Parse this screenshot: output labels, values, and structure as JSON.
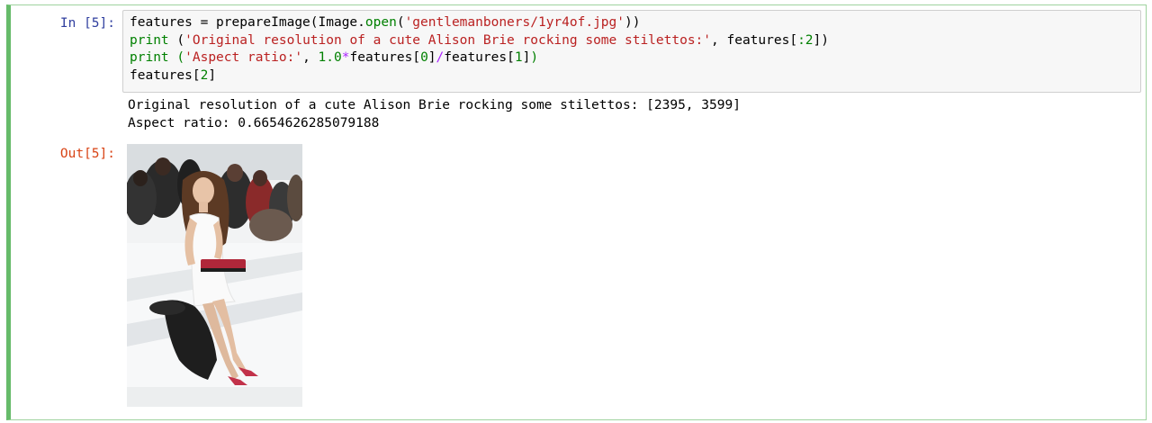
{
  "cell": {
    "input_prompt": "In [5]:",
    "output_prompt": "Out[5]:",
    "code_lines": [
      [
        {
          "text": "features = prepareImage(Image.",
          "cls": "tx"
        },
        {
          "text": "open",
          "cls": "kw"
        },
        {
          "text": "(",
          "cls": "tx"
        },
        {
          "text": "'gentlemanboners/1yr4of.jpg'",
          "cls": "str"
        },
        {
          "text": "))",
          "cls": "tx"
        }
      ],
      [
        {
          "text": "print",
          "cls": "kw"
        },
        {
          "text": " (",
          "cls": "tx"
        },
        {
          "text": "'Original resolution of a cute Alison Brie rocking some stilettos:'",
          "cls": "str"
        },
        {
          "text": ", features[",
          "cls": "tx"
        },
        {
          "text": ":2",
          "cls": "num"
        },
        {
          "text": "])",
          "cls": "tx"
        }
      ],
      [
        {
          "text": "print",
          "cls": "kw"
        },
        {
          "text": " (",
          "cls": "kw"
        },
        {
          "text": "'Aspect ratio:'",
          "cls": "str"
        },
        {
          "text": ", ",
          "cls": "tx"
        },
        {
          "text": "1.0",
          "cls": "num"
        },
        {
          "text": "*",
          "cls": "op"
        },
        {
          "text": "features[",
          "cls": "tx"
        },
        {
          "text": "0",
          "cls": "num"
        },
        {
          "text": "]",
          "cls": "tx"
        },
        {
          "text": "/",
          "cls": "op"
        },
        {
          "text": "features[",
          "cls": "tx"
        },
        {
          "text": "1",
          "cls": "num"
        },
        {
          "text": "]",
          "cls": "tx"
        },
        {
          "text": ")",
          "cls": "kw"
        }
      ],
      [
        {
          "text": "features[",
          "cls": "tx"
        },
        {
          "text": "2",
          "cls": "num"
        },
        {
          "text": "]",
          "cls": "tx"
        }
      ]
    ],
    "stdout_lines": [
      "Original resolution of a cute Alison Brie rocking some stilettos: [2395, 3599]",
      "Aspect ratio: 0.6654626285079188"
    ]
  },
  "colors": {
    "cell_border_active": "#66bb6a",
    "input_prompt": "#303f9f",
    "output_prompt": "#d84315",
    "keyword": "#008000",
    "string": "#ba2121",
    "operator": "#aa22ff"
  }
}
